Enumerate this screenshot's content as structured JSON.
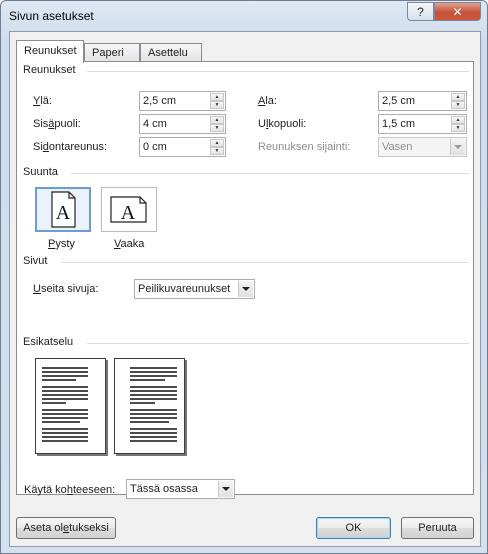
{
  "window": {
    "title": "Sivun asetukset",
    "help_glyph": "?",
    "close_glyph": "✕"
  },
  "tabs": [
    {
      "label": "Reunukset",
      "active": true
    },
    {
      "label": "Paperi",
      "active": false
    },
    {
      "label": "Asettelu",
      "active": false
    }
  ],
  "margins": {
    "group_title": "Reunukset",
    "top": {
      "label_pre": "",
      "label_u": "Y",
      "label_post": "lä:",
      "value": "2,5 cm"
    },
    "bottom": {
      "label_pre": "",
      "label_u": "A",
      "label_post": "la:",
      "value": "2,5 cm"
    },
    "inside": {
      "label_pre": "Sis",
      "label_u": "ä",
      "label_post": "puoli:",
      "value": "4 cm"
    },
    "outside": {
      "label_pre": "U",
      "label_u": "l",
      "label_post": "kopuoli:",
      "value": "1,5 cm"
    },
    "gutter": {
      "label_pre": "Si",
      "label_u": "d",
      "label_post": "ontareunus:",
      "value": "0 cm"
    },
    "gutter_pos": {
      "label": "Reunuksen sijainti:",
      "value": "Vasen"
    }
  },
  "orientation": {
    "group_title": "Suunta",
    "portrait": {
      "glyph": "A",
      "label_pre": "",
      "label_u": "P",
      "label_post": "ysty"
    },
    "landscape": {
      "glyph": "A",
      "label_pre": "",
      "label_u": "V",
      "label_post": "aaka"
    }
  },
  "pages": {
    "group_title": "Sivut",
    "multiple": {
      "label_pre": "",
      "label_u": "U",
      "label_post": "seita sivuja:",
      "value": "Peilikuvareunukset"
    }
  },
  "preview": {
    "group_title": "Esikatselu"
  },
  "apply": {
    "label_pre": "Käytä ko",
    "label_u": "h",
    "label_post": "teeseen:",
    "value": "Tässä osassa"
  },
  "buttons": {
    "default": {
      "label_pre": "Aseta ol",
      "label_u": "e",
      "label_post": "tukseksi"
    },
    "ok": "OK",
    "cancel": "Peruuta"
  },
  "colors": {
    "accent": "#3c7fb1",
    "close": "#c45139",
    "selection": "#6d9bd6"
  }
}
